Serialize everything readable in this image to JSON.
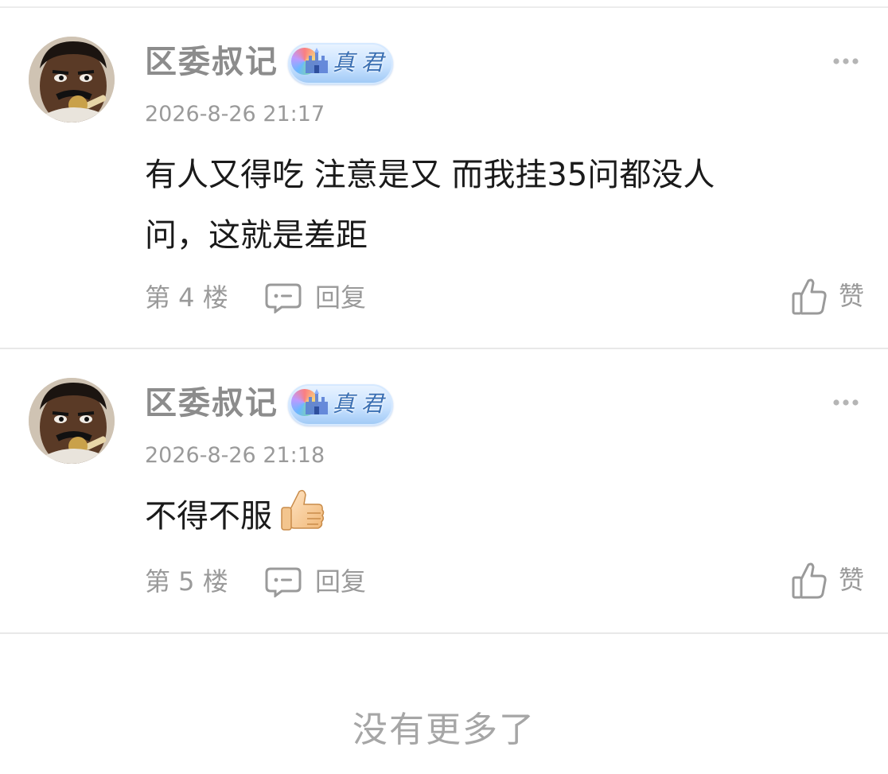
{
  "comments": [
    {
      "username": "区委叔记",
      "badge_text": "真君",
      "timestamp": "2026-8-26 21:17",
      "content_line1": "有人又得吃 注意是又 而我挂35问都没人",
      "content_line2": "问，这就是差距",
      "floor": "第 4 楼",
      "reply_label": "回复",
      "like_label": "赞"
    },
    {
      "username": "区委叔记",
      "badge_text": "真君",
      "timestamp": "2026-8-26 21:18",
      "content_line1": "不得不服",
      "emoji": "thumbs-up",
      "floor": "第 5 楼",
      "reply_label": "回复",
      "like_label": "赞"
    }
  ],
  "no_more_text": "没有更多了",
  "colors": {
    "username": "#8c8c8c",
    "meta": "#9a9a9a",
    "content": "#1a1a1a",
    "divider": "#e8e8e8",
    "badge_text": "#3a6fb3"
  },
  "icons": [
    "avatar-image",
    "badge-icon",
    "more-dots-icon",
    "reply-icon",
    "like-icon",
    "thumbs-up-emoji"
  ]
}
